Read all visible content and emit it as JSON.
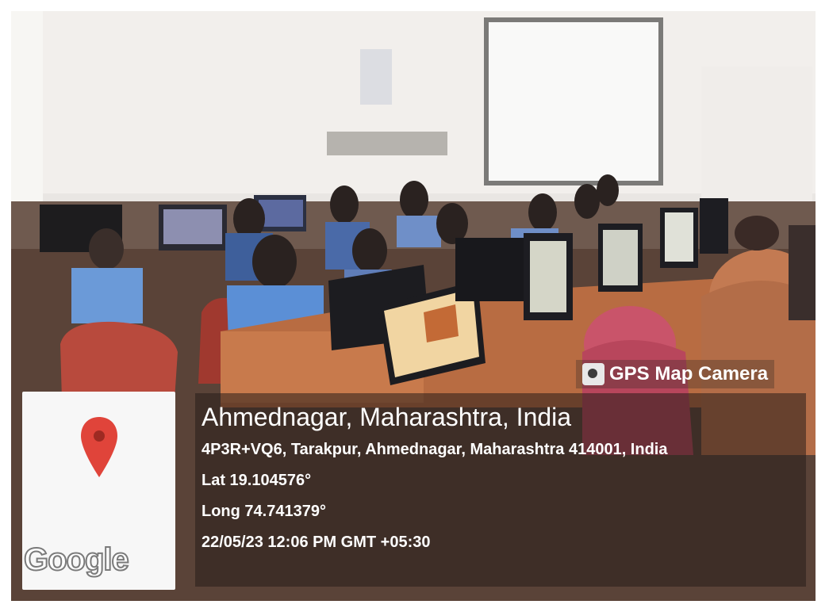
{
  "badge": {
    "icon": "camera-app-icon",
    "label": "GPS Map Camera"
  },
  "location": {
    "title": "Ahmednagar, Maharashtra, India",
    "address": "4P3R+VQ6, Tarakpur, Ahmednagar, Maharashtra 414001, India",
    "lat": "Lat 19.104576°",
    "long": "Long 74.741379°",
    "datetime": "22/05/23 12:06 PM GMT +05:30"
  },
  "map": {
    "logo": "Google",
    "pin_color": "#e0443a"
  },
  "colors": {
    "panel_overlay": "#281e19",
    "wall": "#e9e6e3",
    "shirt_blue": "#5b8fd6",
    "chair_red": "#b84a3d",
    "desk_wood": "#b86c42"
  }
}
